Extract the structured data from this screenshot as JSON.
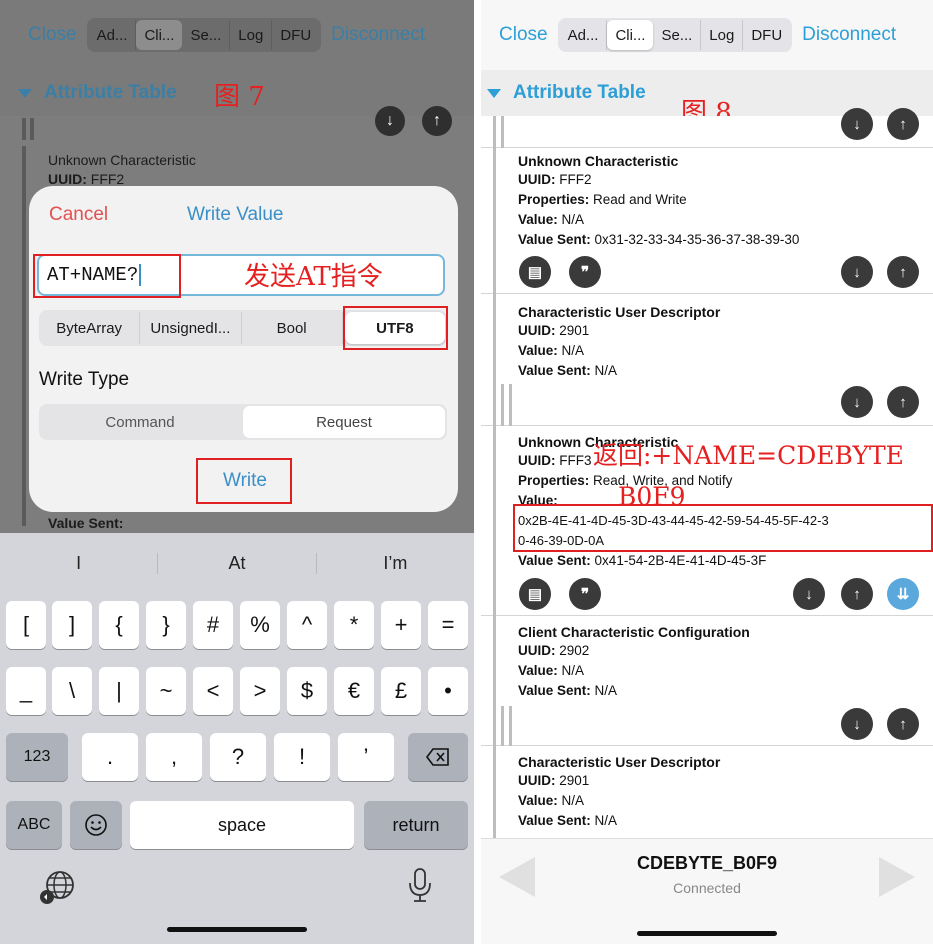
{
  "left": {
    "nav": {
      "close": "Close",
      "disconnect": "Disconnect",
      "tabs": [
        "Ad...",
        "Cli...",
        "Se...",
        "Log",
        "DFU"
      ],
      "active_tab": 1
    },
    "section_title": "Attribute Table",
    "figure_label": "图 7",
    "bg_characteristic": {
      "title": "Unknown Characteristic",
      "uuid_label": "UUID:",
      "uuid": "FFF2"
    },
    "bg_value_sent_label": "Value Sent:",
    "dialog": {
      "cancel": "Cancel",
      "title": "Write Value",
      "input_value": "AT+NAME?",
      "annotation": "发送AT指令",
      "types": [
        "ByteArray",
        "UnsignedI...",
        "Bool",
        "UTF8"
      ],
      "active_type": 3,
      "write_type_label": "Write Type",
      "write_types": [
        "Command",
        "Request"
      ],
      "active_write_type": 1,
      "write_button": "Write"
    },
    "keyboard": {
      "suggestions": [
        "I",
        "At",
        "I’m"
      ],
      "row1": [
        "[",
        "]",
        "{",
        "}",
        "#",
        "%",
        "^",
        "*",
        "+",
        "="
      ],
      "row2": [
        "_",
        "\\",
        "|",
        "~",
        "<",
        ">",
        "$",
        "€",
        "£",
        "•"
      ],
      "row3": [
        ".",
        ",",
        "?",
        "!",
        "’"
      ],
      "k123": "123",
      "abc": "ABC",
      "space": "space",
      "return": "return"
    }
  },
  "right": {
    "nav": {
      "close": "Close",
      "disconnect": "Disconnect",
      "tabs": [
        "Ad...",
        "Cli...",
        "Se...",
        "Log",
        "DFU"
      ],
      "active_tab": 1
    },
    "section_title": "Attribute Table",
    "figure_label": "图 8",
    "labels": {
      "uuid": "UUID:",
      "properties": "Properties:",
      "value": "Value:",
      "value_sent": "Value Sent:"
    },
    "char1": {
      "title": "Unknown Characteristic",
      "uuid": "FFF2",
      "properties": "Read and Write",
      "value": "N/A",
      "value_sent": "0x31-32-33-34-35-36-37-38-39-30"
    },
    "desc1": {
      "title": "Characteristic User Descriptor",
      "uuid": "2901",
      "value": "N/A",
      "value_sent": "N/A"
    },
    "char2": {
      "title": "Unknown Characteristic",
      "uuid": "FFF3",
      "properties": "Read, Write, and Notify",
      "value_line1": "0x2B-4E-41-4D-45-3D-43-44-45-42-59-54-45-5F-42-3",
      "value_line2": "0-46-39-0D-0A",
      "value_sent": "0x41-54-2B-4E-41-4D-45-3F",
      "annotation_line1": "返回:+NAME=CDEBYTE",
      "annotation_line2": "B0F9"
    },
    "ccc": {
      "title": "Client Characteristic Configuration",
      "uuid": "2902",
      "value": "N/A",
      "value_sent": "N/A"
    },
    "desc2": {
      "title": "Characteristic User Descriptor",
      "uuid": "2901",
      "value": "N/A",
      "value_sent": "N/A"
    },
    "device": {
      "name": "CDEBYTE_B0F9",
      "status": "Connected"
    }
  }
}
